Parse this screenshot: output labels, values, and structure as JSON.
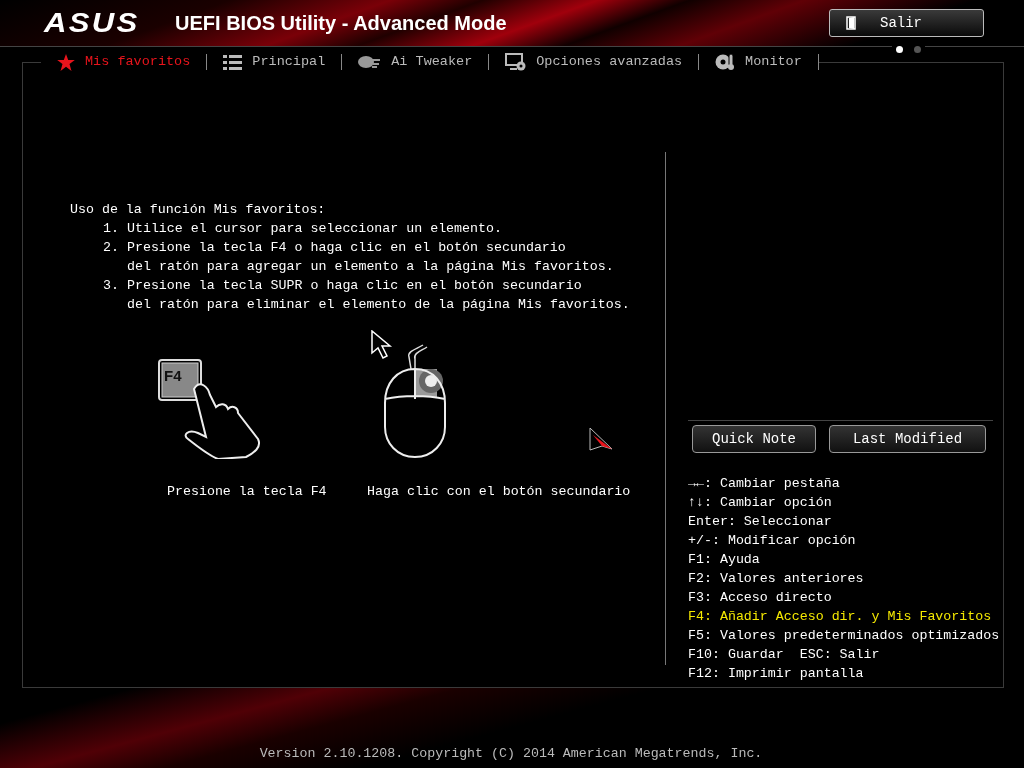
{
  "header": {
    "logo": "ASUS",
    "title": "UEFI BIOS Utility - Advanced Mode",
    "exit_button": "Salir"
  },
  "tabs": [
    {
      "label": "Mis favoritos",
      "selected": true
    },
    {
      "label": "Principal",
      "selected": false
    },
    {
      "label": "Ai Tweaker",
      "selected": false
    },
    {
      "label": "Opciones avanzadas",
      "selected": false
    },
    {
      "label": "Monitor",
      "selected": false
    }
  ],
  "page_dots": [
    {
      "selected": true
    },
    {
      "selected": false
    }
  ],
  "instructions": {
    "heading": "Uso de la función Mis favoritos:",
    "steps": [
      {
        "number": "1.",
        "lines": [
          "Utilice el cursor para seleccionar un elemento."
        ]
      },
      {
        "number": "2.",
        "lines": [
          "Presione la tecla F4 o haga clic en el botón secundario",
          "del ratón para agregar un elemento a la página Mis favoritos."
        ]
      },
      {
        "number": "3.",
        "lines": [
          "Presione la tecla SUPR o haga clic en el botón secundario",
          "del ratón para eliminar el elemento de la página Mis favoritos."
        ]
      }
    ]
  },
  "illustrations": [
    {
      "caption": "Presione la tecla F4",
      "key_label": "F4"
    },
    {
      "caption": "Haga clic con el botón secundario"
    }
  ],
  "side_buttons": [
    "Quick Note",
    "Last Modified"
  ],
  "help": [
    {
      "text": "→←: Cambiar pestaña",
      "highlighted": false
    },
    {
      "text": "↑↓: Cambiar opción",
      "highlighted": false
    },
    {
      "text": "Enter: Seleccionar",
      "highlighted": false
    },
    {
      "text": "+/-: Modificar opción",
      "highlighted": false
    },
    {
      "text": "F1: Ayuda",
      "highlighted": false
    },
    {
      "text": "F2: Valores anteriores",
      "highlighted": false
    },
    {
      "text": "F3: Acceso directo",
      "highlighted": false
    },
    {
      "text": "F4: Añadir Acceso dir. y Mis Favoritos",
      "highlighted": true
    },
    {
      "text": "F5: Valores predeterminados optimizados",
      "highlighted": false
    },
    {
      "text": "F10: Guardar  ESC: Salir",
      "highlighted": false
    },
    {
      "text": "F12: Imprimir pantalla",
      "highlighted": false
    }
  ],
  "footer": "Version 2.10.1208. Copyright (C) 2014 American Megatrends, Inc."
}
